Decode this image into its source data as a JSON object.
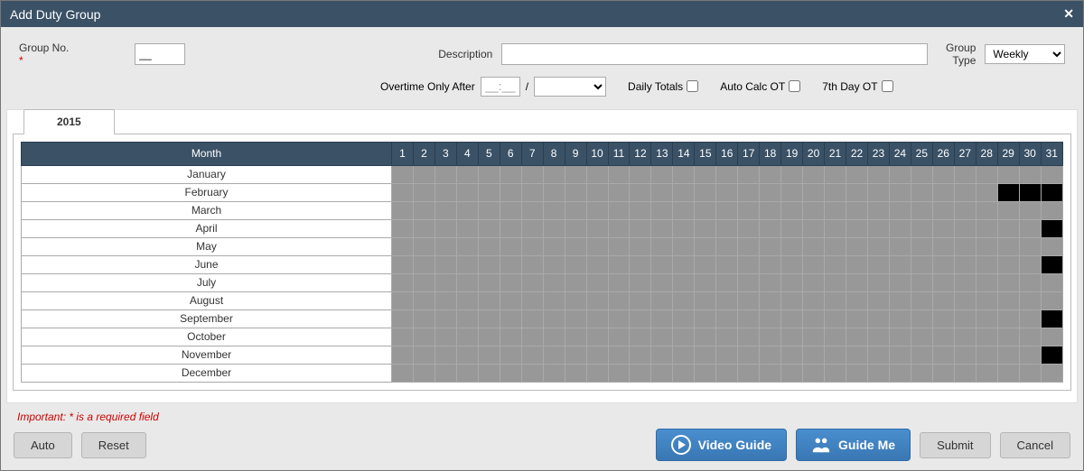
{
  "title": "Add Duty Group",
  "labels": {
    "group_no": "Group No.",
    "description": "Description",
    "group_type": "Group\nType",
    "overtime_only_after": "Overtime Only After",
    "daily_totals": "Daily Totals",
    "auto_calc_ot": "Auto Calc OT",
    "seventh_day_ot": "7th Day OT",
    "slash": "/"
  },
  "form": {
    "group_no_value": "__",
    "description_value": "",
    "group_type_value": "Weekly",
    "group_type_options": [
      "Weekly"
    ],
    "overtime_after_value": "__:__",
    "overtime_after_select": "",
    "overtime_after_options": [
      ""
    ],
    "daily_totals_checked": false,
    "auto_calc_ot_checked": false,
    "seventh_day_ot_checked": false
  },
  "tab_year": "2015",
  "grid": {
    "month_header": "Month",
    "days": [
      1,
      2,
      3,
      4,
      5,
      6,
      7,
      8,
      9,
      10,
      11,
      12,
      13,
      14,
      15,
      16,
      17,
      18,
      19,
      20,
      21,
      22,
      23,
      24,
      25,
      26,
      27,
      28,
      29,
      30,
      31
    ],
    "months": [
      {
        "name": "January",
        "black_days": []
      },
      {
        "name": "February",
        "black_days": [
          29,
          30,
          31
        ]
      },
      {
        "name": "March",
        "black_days": []
      },
      {
        "name": "April",
        "black_days": [
          31
        ]
      },
      {
        "name": "May",
        "black_days": []
      },
      {
        "name": "June",
        "black_days": [
          31
        ]
      },
      {
        "name": "July",
        "black_days": []
      },
      {
        "name": "August",
        "black_days": []
      },
      {
        "name": "September",
        "black_days": [
          31
        ]
      },
      {
        "name": "October",
        "black_days": []
      },
      {
        "name": "November",
        "black_days": [
          31
        ]
      },
      {
        "name": "December",
        "black_days": []
      }
    ]
  },
  "footer": {
    "important_note": "Important: * is a required field",
    "auto": "Auto",
    "reset": "Reset",
    "video_guide": "Video Guide",
    "guide_me": "Guide Me",
    "submit": "Submit",
    "cancel": "Cancel"
  }
}
